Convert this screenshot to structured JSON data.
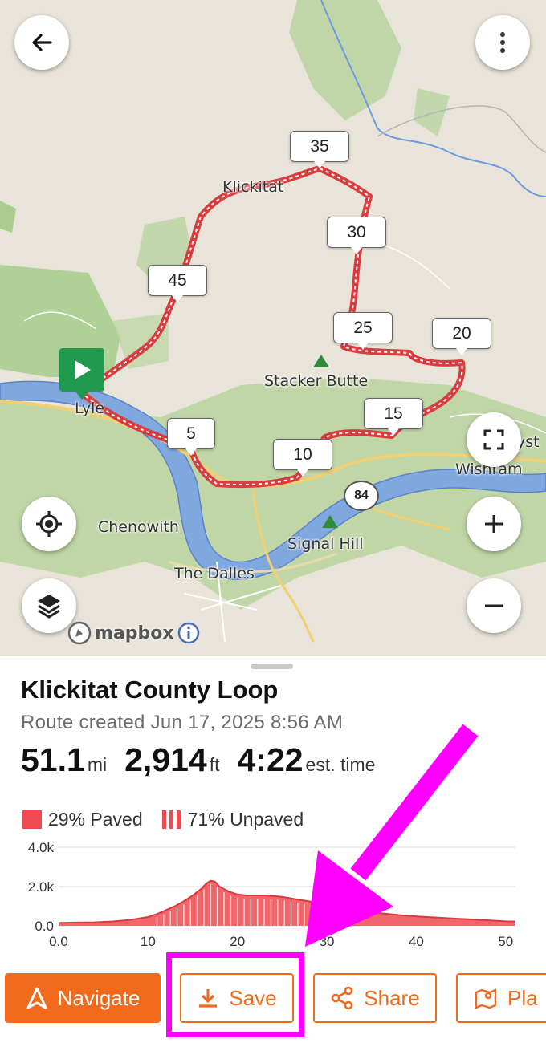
{
  "map": {
    "place_labels": {
      "klickitat": "Klickitat",
      "stacker_butte": "Stacker Butte",
      "lyle": "Lyle",
      "wishram": "Wishram",
      "chenowith": "Chenowith",
      "signal_hill": "Signal Hill",
      "the_dalles": "The Dalles",
      "partial_label": "yst"
    },
    "highway_shield": "84",
    "mile_markers": [
      "35",
      "30",
      "45",
      "25",
      "20",
      "15",
      "5",
      "10"
    ],
    "attribution": "mapbox"
  },
  "route": {
    "title": "Klickitat County Loop",
    "created": "Route created Jun 17, 2025 8:56 AM",
    "distance": "51.1",
    "distance_unit": "mi",
    "elevation_gain": "2,914",
    "elevation_unit": "ft",
    "duration": "4:22",
    "duration_unit": "est. time"
  },
  "surface": {
    "paved": "29% Paved",
    "unpaved": "71% Unpaved"
  },
  "chart_data": {
    "type": "area",
    "ylim": [
      0,
      4000
    ],
    "xlim": [
      0,
      51.1
    ],
    "y_ticks": [
      "4.0k",
      "2.0k",
      "0.0"
    ],
    "x_ticks": [
      "0.0",
      "10",
      "20",
      "30",
      "40",
      "50"
    ],
    "x": [
      0,
      2,
      4,
      6,
      8,
      10,
      11,
      12,
      13,
      14,
      15,
      16,
      16.5,
      17,
      17.5,
      18,
      19,
      20,
      21,
      22,
      23,
      24,
      25,
      26,
      27,
      28,
      29,
      30,
      31,
      32,
      34,
      36,
      38,
      40,
      42,
      44,
      46,
      48,
      50,
      51.1
    ],
    "y": [
      150,
      170,
      180,
      220,
      300,
      450,
      600,
      800,
      1000,
      1250,
      1550,
      1900,
      2150,
      2300,
      2250,
      2000,
      1750,
      1600,
      1550,
      1550,
      1550,
      1520,
      1480,
      1400,
      1320,
      1250,
      1150,
      1050,
      950,
      850,
      750,
      650,
      550,
      480,
      430,
      380,
      330,
      280,
      230,
      220
    ],
    "colors": {
      "fill": "#ef4b51"
    }
  },
  "actions": {
    "navigate": "Navigate",
    "save": "Save",
    "share": "Share",
    "plan": "Pla"
  },
  "colors": {
    "accent": "#f26b1d",
    "route": "#ef4b51",
    "highlight": "#ff00ff",
    "start": "#1f9a4f"
  }
}
